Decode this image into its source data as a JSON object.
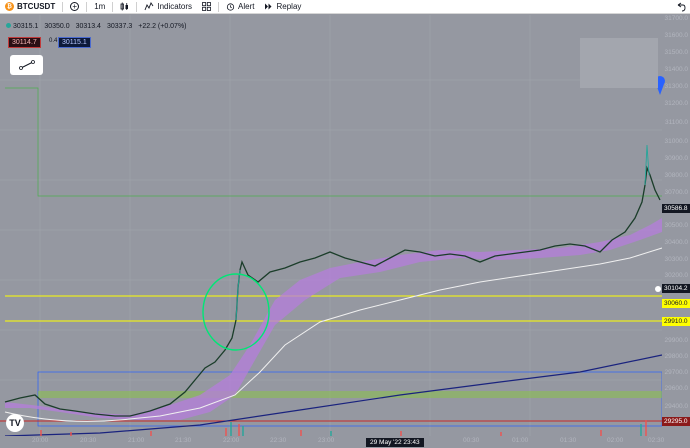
{
  "toolbar": {
    "symbol": "BTCUSDT",
    "interval": "1m",
    "indicators_label": "Indicators",
    "alert_label": "Alert",
    "replay_label": "Replay"
  },
  "legend": {
    "open": "30315.1",
    "high": "30350.0",
    "low": "30313.4",
    "close": "30337.3",
    "change": "+22.2 (+0.07%)"
  },
  "order": {
    "sell_price": "30114.7",
    "spread": "0.4",
    "buy_price": "30115.1"
  },
  "price_axis": [
    "31700.0",
    "31600.0",
    "31500.0",
    "31400.0",
    "31300.0",
    "31200.0",
    "31100.0",
    "31000.0",
    "30900.0",
    "30800.0",
    "30700.0",
    "30600.0",
    "30500.0",
    "30400.0",
    "30300.0",
    "30200.0",
    "30100.0",
    "30000.0",
    "29900.0",
    "29800.0",
    "29700.0",
    "29600.0",
    "29500.0",
    "29400.0",
    "29300.0"
  ],
  "price_tags": {
    "current": "30586.8",
    "level1": "30104.2",
    "level2": "30060.0",
    "level3": "29910.0",
    "level4": "29295.0"
  },
  "time_axis": [
    "20:00",
    "20:30",
    "21:00",
    "21:30",
    "22:00",
    "22:30",
    "23:00",
    "00:30",
    "01:00",
    "01:30",
    "02:00",
    "02:30"
  ],
  "crosshair_time": "29 May '22  23:43",
  "colors": {
    "background": "#9598a1",
    "up": "#26a69a",
    "down": "#ef5350",
    "yellow_line": "#ffff00",
    "ribbon": "#b57edc",
    "ma_white": "#f0f0f0",
    "ma_blue": "#1a237e"
  }
}
